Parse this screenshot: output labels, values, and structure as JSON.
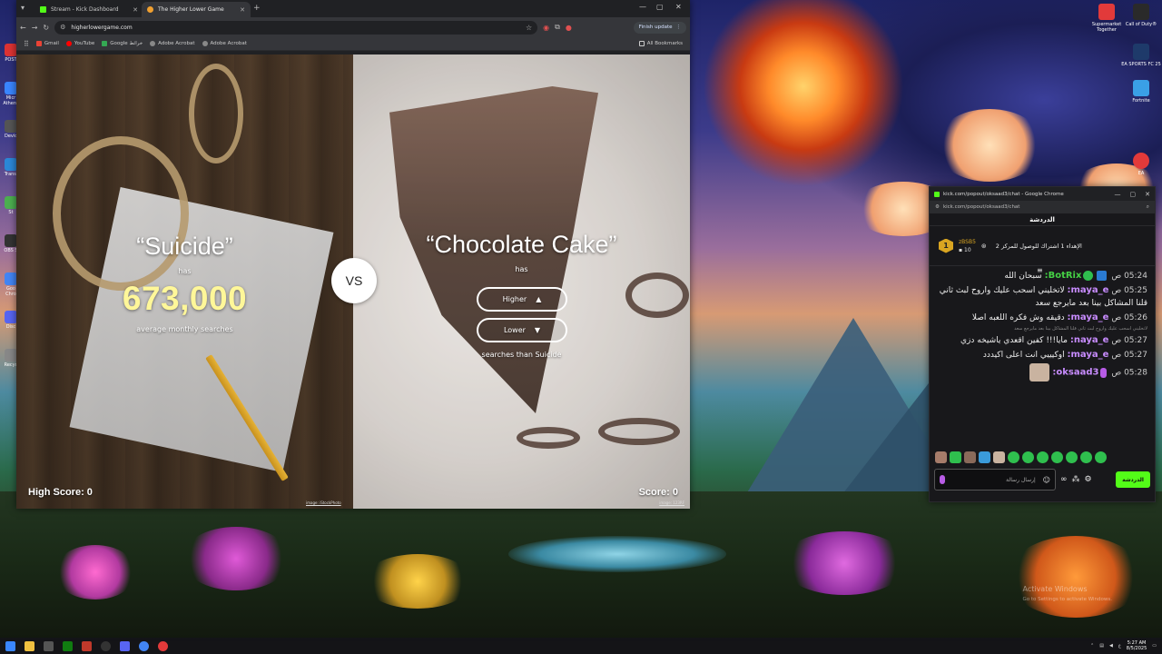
{
  "browser": {
    "tabs": [
      {
        "label": "Stream - Kick Dashboard",
        "favicon_color": "#53fc18",
        "active": false
      },
      {
        "label": "The Higher Lower Game",
        "favicon_color": "#f0a030",
        "active": true
      }
    ],
    "url": "higherlowergame.com",
    "finish_update_label": "Finish update",
    "bookmarks": [
      {
        "label": "Gmail",
        "color": "#ea4335"
      },
      {
        "label": "YouTube",
        "color": "#ff0000"
      },
      {
        "label": "Google خرائط",
        "color": "#34a853"
      },
      {
        "label": "Adobe Acrobat",
        "color": "#888888"
      },
      {
        "label": "Adobe Acrobat",
        "color": "#888888"
      }
    ],
    "all_bookmarks_label": "All Bookmarks"
  },
  "game": {
    "left": {
      "title": "“Suicide”",
      "has": "has",
      "searches": "673,000",
      "avg_label": "average monthly searches",
      "credit": "image: iStockPhoto"
    },
    "vs": "VS",
    "right": {
      "title": "“Chocolate Cake”",
      "has": "has",
      "higher_label": "Higher",
      "lower_label": "Lower",
      "compare_label": "searches than Suicide",
      "credit": "image: 123RF"
    },
    "high_score": "High Score: 0",
    "score": "Score: 0"
  },
  "chat": {
    "window_title": "kick.com/popout/oksaad3/chat - Google Chrome",
    "url": "kick.com/popout/oksaad3/chat",
    "header": "الدردشة",
    "pinned": {
      "badge": "1",
      "user": "zBSB5",
      "count": "10",
      "text": "الإهداء 1 اشتراك للوصول للمركز 2"
    },
    "messages": [
      {
        "time": "05:24 ص",
        "user": "BotRix:",
        "user_color": "#45d145",
        "text": "سبحان الله",
        "badge": "bot"
      },
      {
        "time": "05:25 ص",
        "user": "maya_e:",
        "user_color": "#c88cff",
        "text": "لاتخليني اسحب عليك واروح لبث ثاني قلنا المشاكل بينا بعد مايرجع سعد",
        "badge": "none"
      },
      {
        "time": "05:26 ص",
        "user": "maya_e:",
        "user_color": "#c88cff",
        "text": "دقيقه وش فكره اللعبه اصلا",
        "badge": "none"
      },
      {
        "time": "05:27 ص",
        "user": "naya_e:",
        "user_color": "#c88cff",
        "text": "مايا!!! كفين اقعدي ياشيخه دزي",
        "badge": "none"
      },
      {
        "time": "05:27 ص",
        "user": "maya_e:",
        "user_color": "#c88cff",
        "text": "اوكيييي انت اعلى اكيددد",
        "badge": "none"
      },
      {
        "time": "05:28 ص",
        "user": "oksaad3:",
        "user_color": "#c88cff",
        "text": "",
        "badge": "mic"
      }
    ],
    "reply_preview": "لاتخليني اسحب عليك واروح لبث ثاني قلنا المشاكل بينا بعد مايرجع سعد",
    "input_placeholder": "إرسال رسالة",
    "send_label": "الدردشة"
  },
  "desktop": {
    "right_icons": [
      {
        "label": "Supermarket Together",
        "color": "#e23a3a"
      },
      {
        "label": "Call of Duty®",
        "color": "#2a2a2a"
      },
      {
        "label": "EA SPORTS FC 25",
        "color": "#1e3a6a"
      },
      {
        "label": "Fortnite",
        "color": "#3aa0e6"
      },
      {
        "label": "EA",
        "color": "#e23a3a"
      }
    ],
    "left_icons": [
      "POST",
      "Micr Athens",
      "Devic",
      "Transl",
      "St",
      "OBS S",
      "Goo Chro",
      "Disc",
      "Recyc"
    ],
    "activate_title": "Activate Windows",
    "activate_sub": "Go to Settings to activate Windows.",
    "clock_time": "5:27 AM",
    "clock_date": "8/5/2025"
  }
}
